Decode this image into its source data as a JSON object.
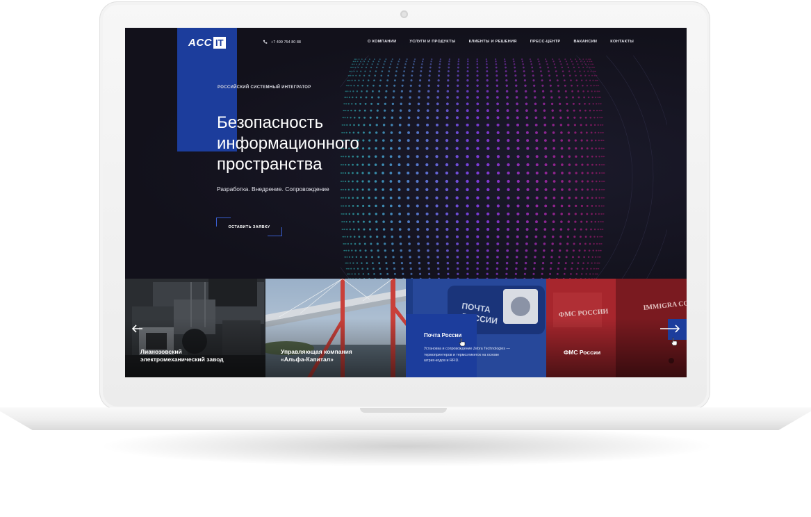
{
  "header": {
    "logo_left": "ACC",
    "logo_right": "IT",
    "phone": "+7 499 754 80 88",
    "nav": [
      "О КОМПАНИИ",
      "УСЛУГИ И ПРОДУКТЫ",
      "КЛИЕНТЫ И РЕШЕНИЯ",
      "ПРЕСС-ЦЕНТР",
      "ВАКАНСИИ",
      "КОНТАКТЫ"
    ]
  },
  "hero": {
    "kicker": "РОССИЙСКИЙ СИСТЕМНЫЙ ИНТЕГРАТОР",
    "title_line1": "Безопасность",
    "title_line2": "информационного",
    "title_line3": "пространства",
    "subtitle": "Разработка.  Внедрение.  Сопровождение",
    "cta": "ОСТАВИТЬ ЗАЯВКУ"
  },
  "cards": [
    {
      "label_line1": "Лианозовский",
      "label_line2": "электромеханический завод"
    },
    {
      "label_line1": "Управляющая компания",
      "label_line2": "«Альфа-Капитал»"
    },
    {
      "title": "Почта России",
      "desc_line1": "Установка и сопровождение Zebra Technologies —",
      "desc_line2": "термопринтеров и термоэтикеток на основе",
      "desc_line3": "штрих-кодов и RFID.",
      "sign_line1": "ПОЧТА",
      "sign_line2": "РОССИИ"
    },
    {
      "label_line1": "ФМС России",
      "patch_text": "ФМС РОССИИ",
      "patch_text2": "IMMIGRA CONTRO"
    }
  ],
  "colors": {
    "accent": "#1c3d9c",
    "background": "#14131f",
    "dots_start": "#2fd9d0",
    "dots_end": "#c2187a"
  }
}
